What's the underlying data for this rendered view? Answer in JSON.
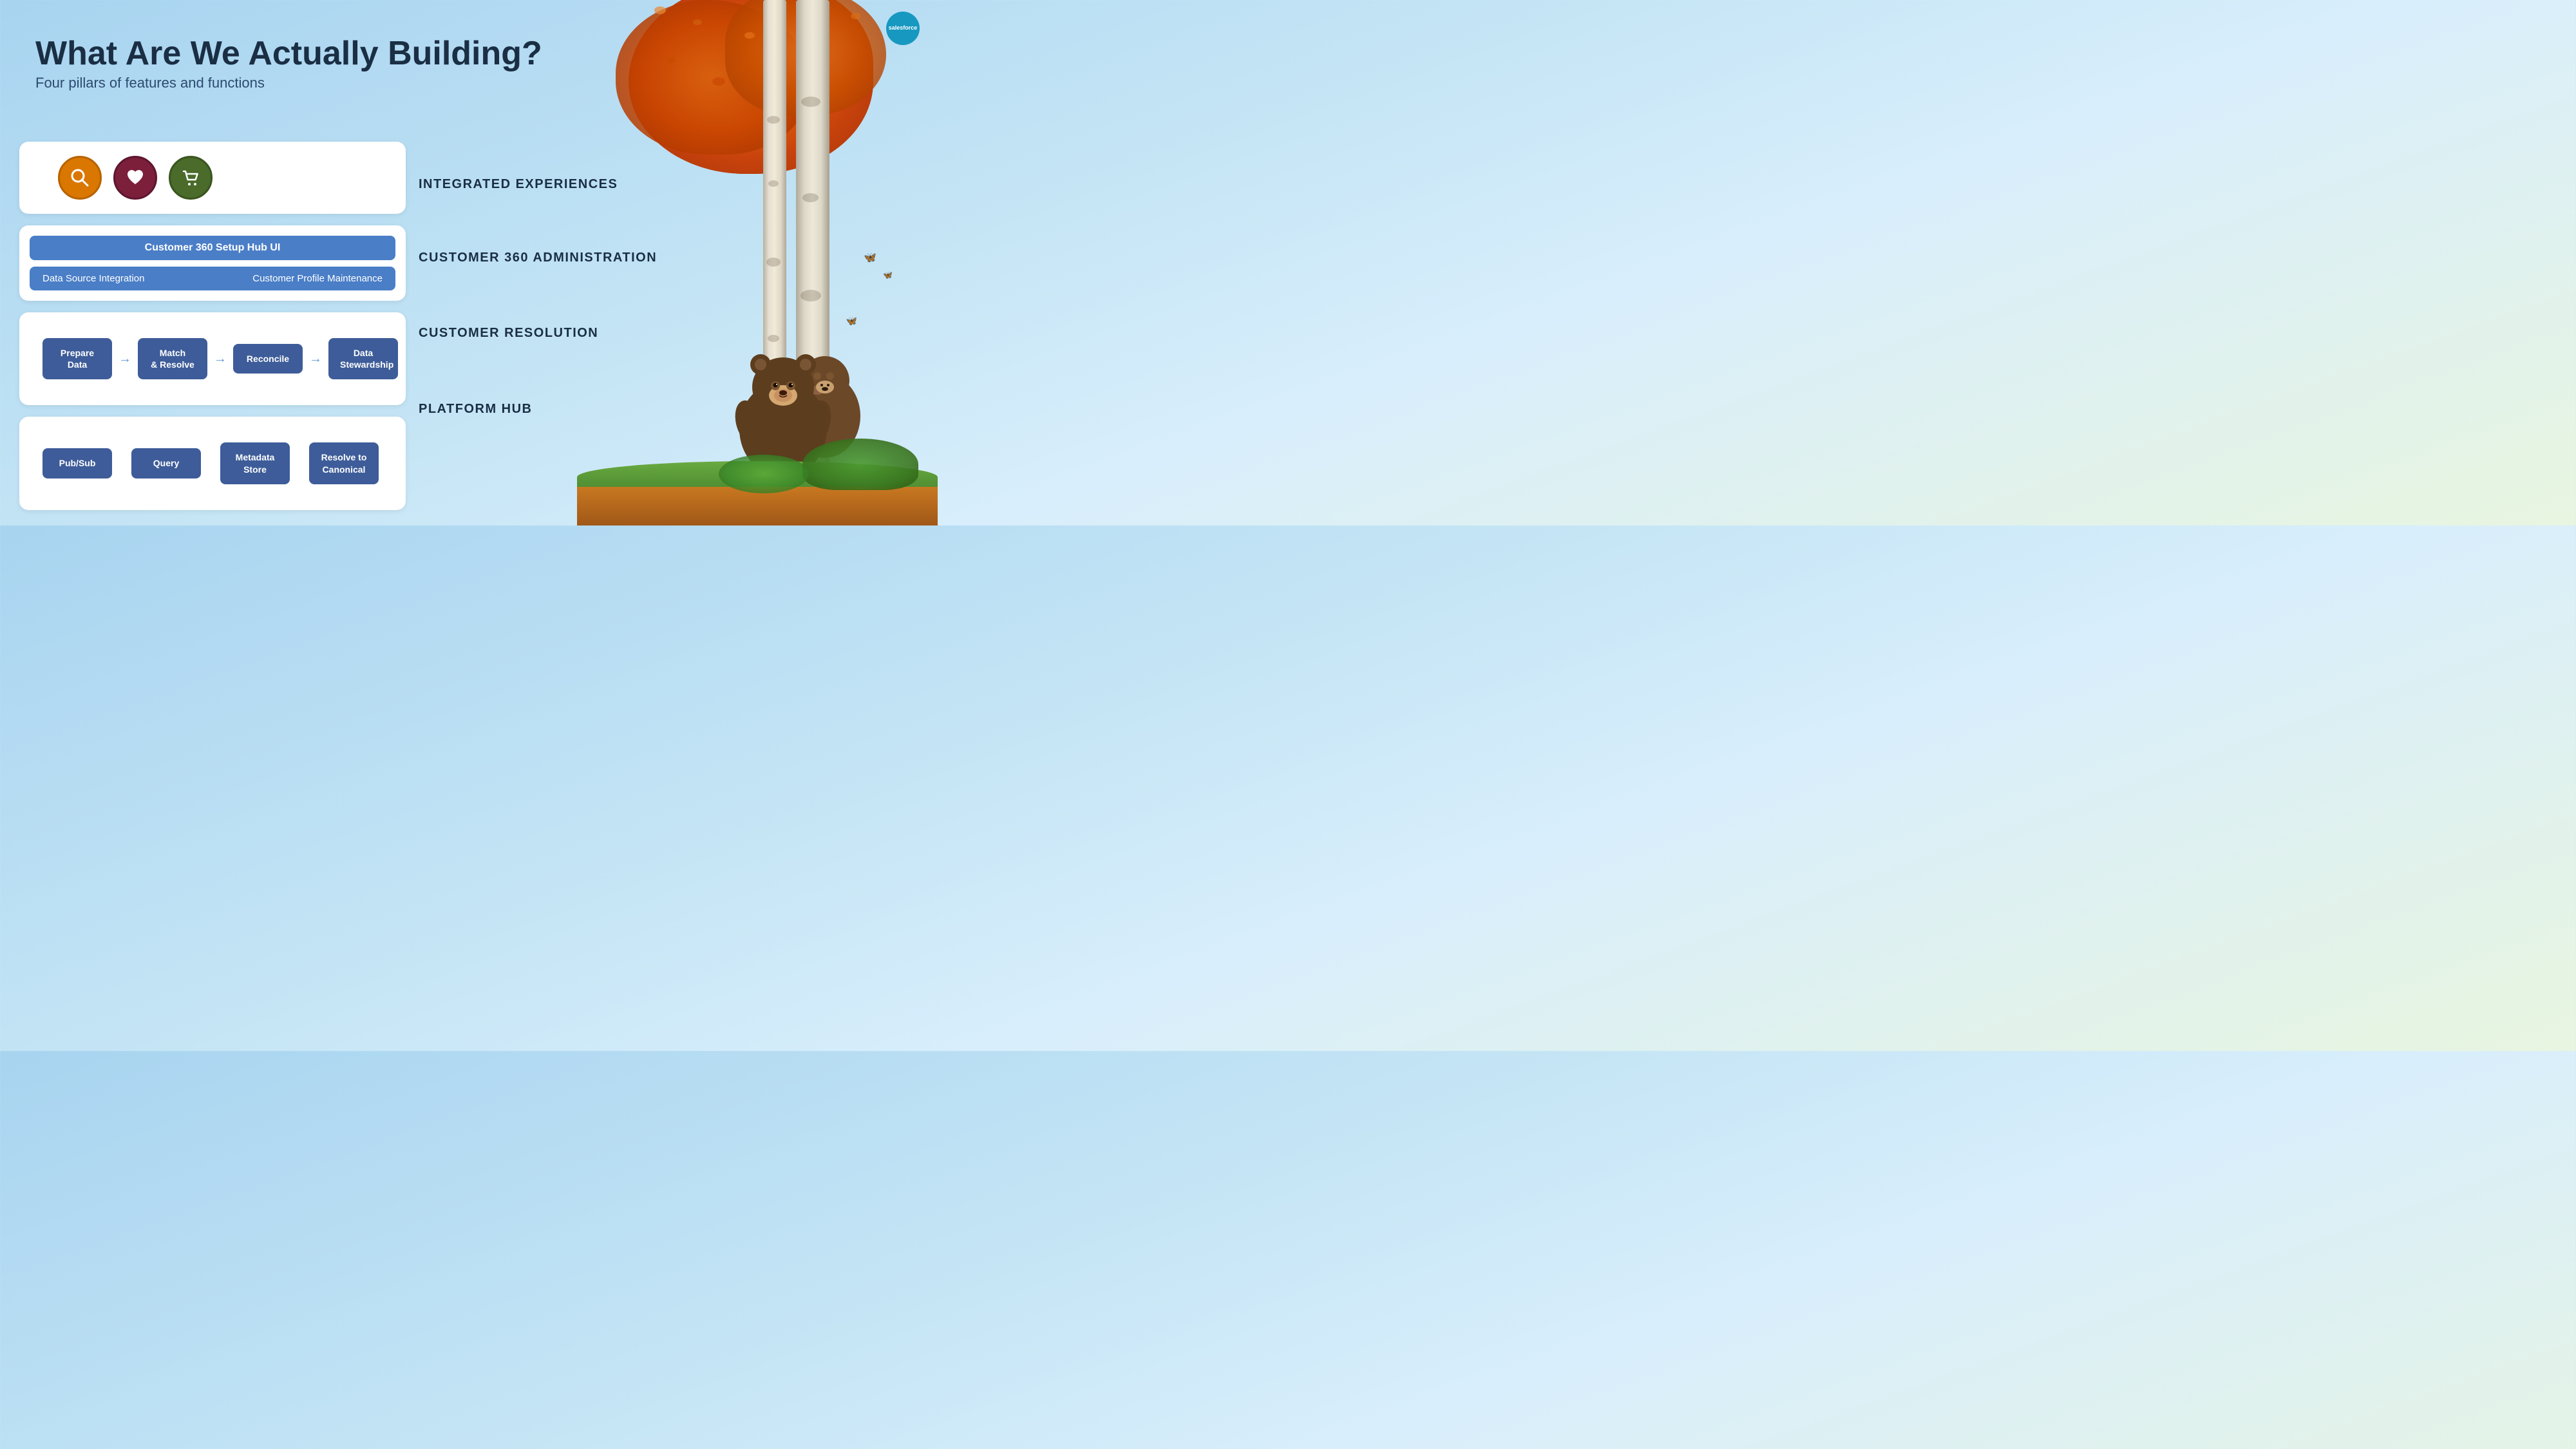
{
  "logo": {
    "text": "salesforce"
  },
  "header": {
    "title": "What Are We Actually Building?",
    "subtitle": "Four pillars of features and functions"
  },
  "pillar1": {
    "label": "INTEGRATED EXPERIENCES",
    "icons": [
      {
        "name": "search-icon",
        "symbol": "🔍",
        "color": "orange",
        "emoji": "⊕"
      },
      {
        "name": "heart-icon",
        "symbol": "♥",
        "color": "maroon"
      },
      {
        "name": "cart-icon",
        "symbol": "🛒",
        "color": "green"
      }
    ]
  },
  "pillar2": {
    "label": "CUSTOMER 360 ADMINISTRATION",
    "top_bar": "Customer 360 Setup Hub UI",
    "bottom_left": "Data Source Integration",
    "bottom_right": "Customer Profile Maintenance"
  },
  "pillar3": {
    "label": "CUSTOMER RESOLUTION",
    "steps": [
      {
        "text": "Prepare Data"
      },
      {
        "text": "Match\n& Resolve"
      },
      {
        "text": "Reconcile"
      },
      {
        "text": "Data\nStewardship"
      }
    ],
    "arrow": "→"
  },
  "pillar4": {
    "label": "PLATFORM HUB",
    "steps": [
      {
        "text": "Pub/Sub"
      },
      {
        "text": "Query"
      },
      {
        "text": "Metadata\nStore"
      },
      {
        "text": "Resolve to\nCanonical"
      }
    ]
  },
  "colors": {
    "background_start": "#a8d4f0",
    "background_end": "#e8f5e0",
    "card_bg": "#ffffff",
    "btn_bg": "#3d5c99",
    "admin_bar_bg": "#4a7ec7",
    "header_title": "#1a2e44",
    "label_text": "#1a2e44",
    "salesforce_blue": "#1798c1"
  }
}
